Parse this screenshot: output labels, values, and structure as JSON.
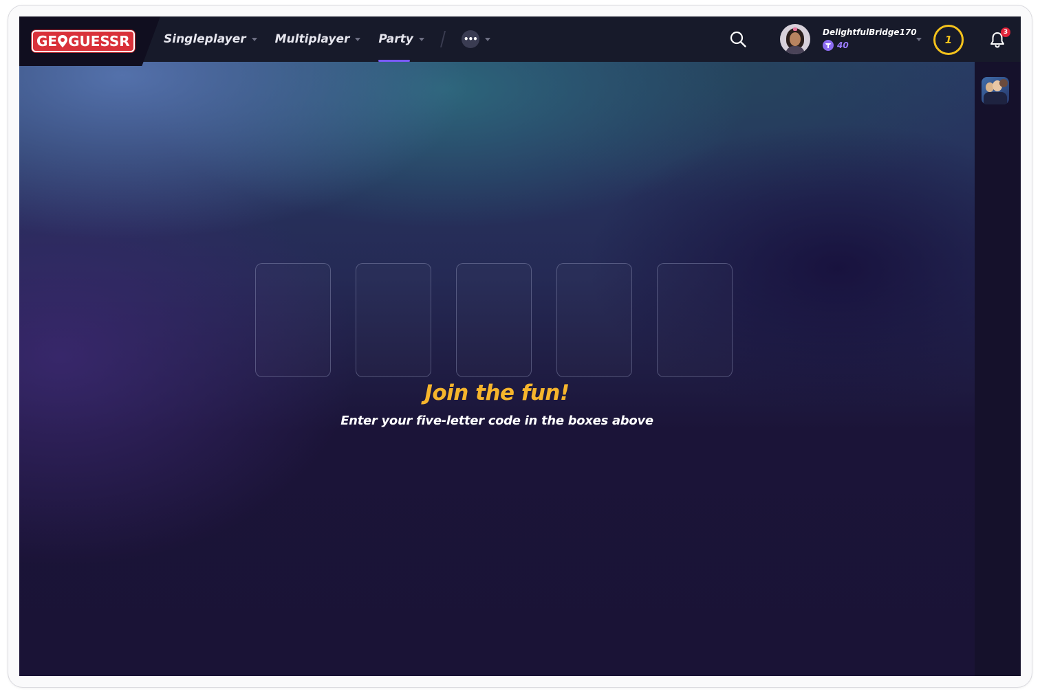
{
  "brand": {
    "logo_prefix": "GE",
    "logo_suffix": "GUESSR",
    "accent": "#d9313a"
  },
  "nav": {
    "items": [
      {
        "label": "Singleplayer",
        "active": false
      },
      {
        "label": "Multiplayer",
        "active": false
      },
      {
        "label": "Party",
        "active": true
      }
    ],
    "more_label": "•••",
    "active_color": "#7a5af8"
  },
  "user": {
    "name": "DelightfulBridge170",
    "coins": "40",
    "level": "1",
    "notifications": "3"
  },
  "main": {
    "title": "Join the fun!",
    "subtitle": "Enter your five-letter code in the boxes above",
    "code_slots": [
      "",
      "",
      "",
      "",
      ""
    ],
    "title_color": "#f6b52c"
  },
  "icons": [
    "search-icon",
    "coin-icon",
    "bell-icon",
    "chevron-down-icon",
    "pin-icon"
  ]
}
